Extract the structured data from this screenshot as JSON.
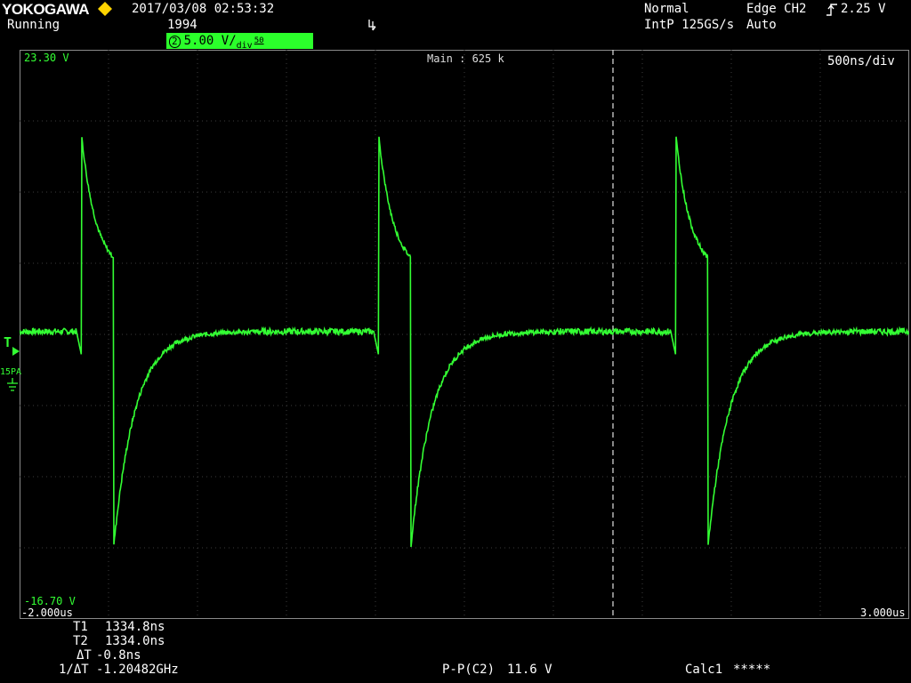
{
  "header": {
    "brand": "YOKOGAWA",
    "status": "Running",
    "datetime": "2017/03/08 02:53:32",
    "record_count": "1994",
    "trigger_mode": "Normal",
    "sample_mode": "IntP 125GS/s",
    "trigger_type": "Edge CH2",
    "trigger_level": "2.25 V",
    "trigger_auto": "Auto",
    "channel_label": "2",
    "volts_per_div": "5.00 V",
    "div_unit": "div",
    "impedance": "50"
  },
  "plot": {
    "top_voltage": "23.30 V",
    "bottom_voltage": "-16.70 V",
    "main_label": "Main : 625 k",
    "time_per_div": "500ns/div",
    "left_time": "-2.000us",
    "right_time": "3.000us",
    "probe_label": "15PA",
    "trigger_marker": "T",
    "colors": {
      "trace": "#33ff33",
      "grid": "#3c3c3c",
      "background": "#000000"
    }
  },
  "measurements": {
    "t1_label": "T1",
    "t1_value": "1334.8ns",
    "t2_label": "T2",
    "t2_value": "1334.0ns",
    "dt_label": "ΔT",
    "dt_value": "-0.8ns",
    "inv_dt_label": "1/ΔT",
    "inv_dt_value": "-1.20482GHz",
    "pp_label": "P-P(C2)",
    "pp_value": "11.6 V",
    "calc_label": "Calc1",
    "calc_value": "*****"
  },
  "chart_data": {
    "type": "line",
    "x_unit": "us",
    "y_unit": "V",
    "xlim": [
      -2.0,
      3.0
    ],
    "ylim": [
      -16.7,
      23.3
    ],
    "baseline_v": 3.5,
    "pulses": [
      {
        "rise_us": -1.65,
        "peak_v": 17.1,
        "decay_end_us": -1.47,
        "decay_end_v": 8.7,
        "fall_us": -1.47,
        "min_v": -11.5
      },
      {
        "rise_us": 0.02,
        "peak_v": 17.1,
        "decay_end_us": 0.2,
        "decay_end_v": 8.7,
        "fall_us": 0.2,
        "min_v": -11.5
      },
      {
        "rise_us": 1.69,
        "peak_v": 17.1,
        "decay_end_us": 1.87,
        "decay_end_v": 8.7,
        "fall_us": 1.87,
        "min_v": -11.5
      }
    ]
  }
}
